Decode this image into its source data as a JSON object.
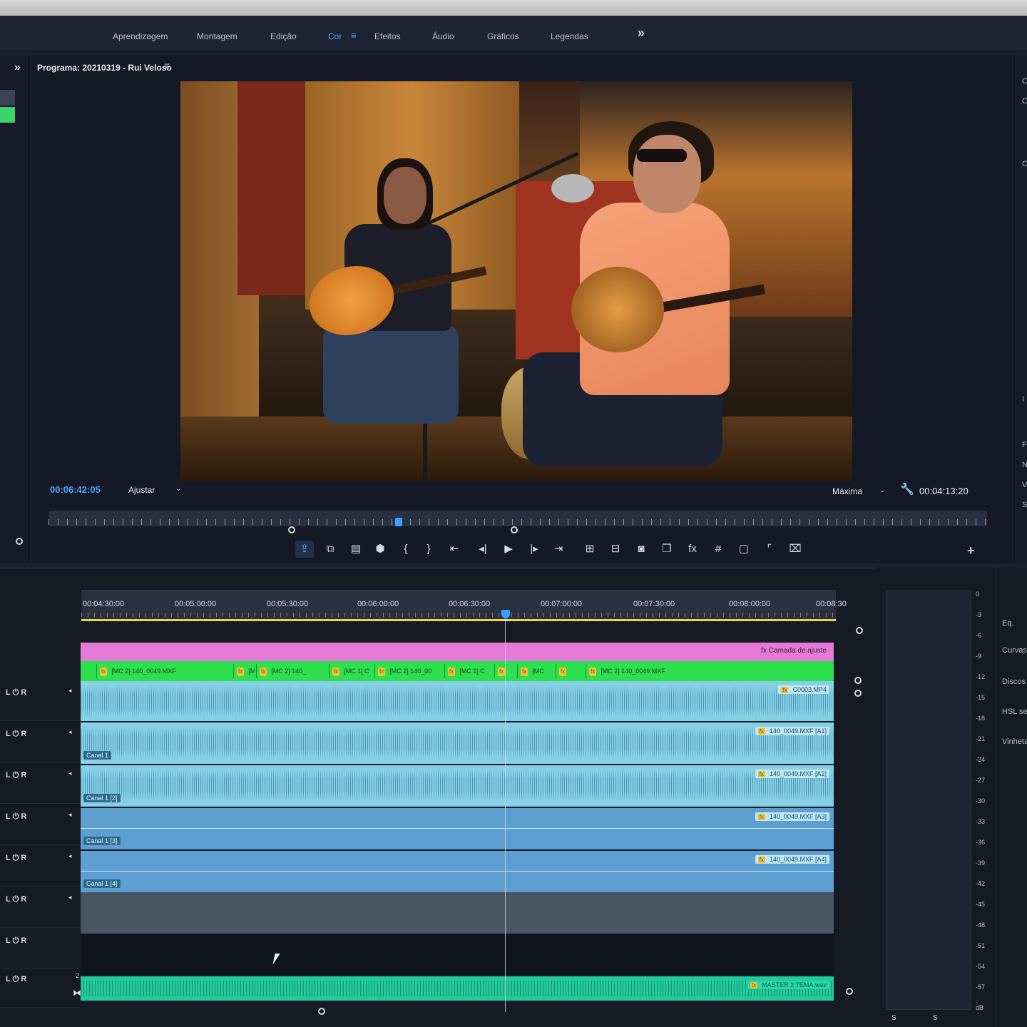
{
  "workspaces": {
    "tabs": [
      {
        "label": "Aprendizagem"
      },
      {
        "label": "Montagem"
      },
      {
        "label": "Edição"
      },
      {
        "label": "Cor"
      },
      {
        "label": "Efeitos"
      },
      {
        "label": "Áudio"
      },
      {
        "label": "Gráficos"
      },
      {
        "label": "Legendas"
      }
    ],
    "active_tab": "Cor",
    "menu_icon": "hamburger-icon",
    "more_icon": "double-chevron-right-icon",
    "more_glyph": "»"
  },
  "left_panel": {
    "expand_glyph": "»"
  },
  "program_monitor": {
    "title": "Programa: 20210319 - Rui Veloso",
    "menu_glyph": "≡",
    "current_timecode": "00:06:42:05",
    "fit": "Ajustar",
    "quality": "Máxima",
    "duration_timecode": "00:04:13:20",
    "playhead_fraction": 0.39,
    "transport_buttons": [
      {
        "name": "export-frame-icon",
        "glyph": "⇪"
      },
      {
        "name": "lift-icon",
        "glyph": "⧉"
      },
      {
        "name": "extract-icon",
        "glyph": "▤"
      },
      {
        "name": "marker-icon",
        "glyph": "⬢"
      },
      {
        "name": "mark-in-icon",
        "glyph": "{"
      },
      {
        "name": "mark-out-icon",
        "glyph": "}"
      },
      {
        "name": "go-to-in-icon",
        "glyph": "⇤"
      },
      {
        "name": "step-back-icon",
        "glyph": "◂|"
      },
      {
        "name": "play-icon",
        "glyph": "▶"
      },
      {
        "name": "step-forward-icon",
        "glyph": "|▸"
      },
      {
        "name": "go-to-out-icon",
        "glyph": "⇥"
      },
      {
        "name": "insert-icon",
        "glyph": "⊞"
      },
      {
        "name": "overwrite-icon",
        "glyph": "⊟"
      },
      {
        "name": "camera-icon",
        "glyph": "◙"
      },
      {
        "name": "compare-icon",
        "glyph": "❐"
      },
      {
        "name": "fx-icon",
        "glyph": "fx"
      },
      {
        "name": "safe-margins-icon",
        "glyph": "#"
      },
      {
        "name": "multicam-icon",
        "glyph": "▢"
      },
      {
        "name": "comparison-view-icon",
        "glyph": "⌜"
      },
      {
        "name": "vr-icon",
        "glyph": "⌧"
      }
    ],
    "add_glyph": "+"
  },
  "right_strip": {
    "labels": [
      "C",
      "C",
      "Co",
      "I",
      "F",
      "N",
      "V",
      "S"
    ]
  },
  "timeline": {
    "ruler_labels": [
      "00:04:30:00",
      "00:05:00:00",
      "00:05:30:00",
      "00:06:00:00",
      "00:06:30:00",
      "00:07:00:00",
      "00:07:30:00",
      "00:08:00:00",
      "00:08:30"
    ],
    "track_control": "L ⏻ R",
    "adjustment_layer": "Camada de ajuste",
    "video_clips": [
      "[MC 2] 140_0049.MXF",
      "[M",
      "[MC 2] 140_",
      "[MC 1] C",
      "[MC 2] 140_00",
      "[MC 1] C",
      "",
      "[MC",
      "",
      "[MC 2] 140_0049.MXF"
    ],
    "audio_clips": [
      {
        "label": "C0003.MP4",
        "canal": ""
      },
      {
        "label": "140_0049.MXF [A1]",
        "canal": "Canal 1"
      },
      {
        "label": "140_0049.MXF [A2]",
        "canal": "Canal 1 [2]"
      },
      {
        "label": "140_0049.MXF [A3]",
        "canal": "Canal 1 [3]"
      },
      {
        "label": "140_0049.MXF [A4]",
        "canal": "Canal 1 [4]"
      }
    ],
    "master_clip": "MASTER 2 TEMA.wav",
    "master_track_number": "2",
    "fx_badge": "fx"
  },
  "audio_meter": {
    "scale": [
      "0",
      "-3",
      "-6",
      "-9",
      "-12",
      "-15",
      "-18",
      "-21",
      "-24",
      "-27",
      "-30",
      "-33",
      "-36",
      "-39",
      "-42",
      "-45",
      "-48",
      "-51",
      "-54",
      "-57",
      "dB"
    ],
    "footer": [
      "S",
      "S"
    ]
  },
  "lumetri_panel": {
    "items": [
      "Eq.",
      "Curvas",
      "Discos",
      "HSL se",
      "Vinheta"
    ]
  },
  "colors": {
    "accent": "#4ea2ff",
    "adjustment_layer": "#e47ad6",
    "video_clip": "#2ee04f",
    "audio_clip": "#86d0e6",
    "master_clip": "#21c99b"
  }
}
